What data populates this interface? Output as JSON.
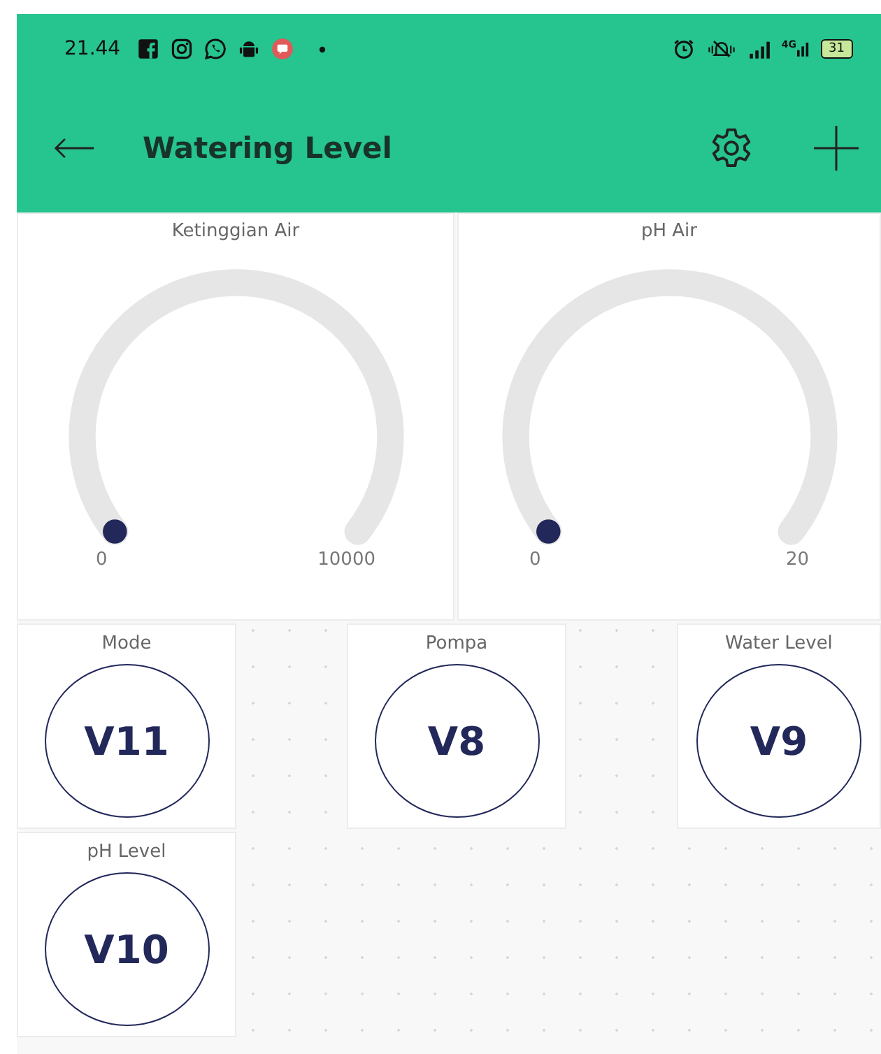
{
  "status_bar": {
    "time": "21.44",
    "network": "4G",
    "battery": "31"
  },
  "header": {
    "title": "Watering Level"
  },
  "gauges": [
    {
      "label": "Ketinggian Air",
      "min": "0",
      "max": "10000"
    },
    {
      "label": "pH Air",
      "min": "0",
      "max": "20"
    }
  ],
  "widgets": [
    {
      "label": "Mode",
      "pin": "V11"
    },
    {
      "label": "Pompa",
      "pin": "V8"
    },
    {
      "label": "Water Level",
      "pin": "V9"
    },
    {
      "label": "pH Level",
      "pin": "V10"
    }
  ]
}
